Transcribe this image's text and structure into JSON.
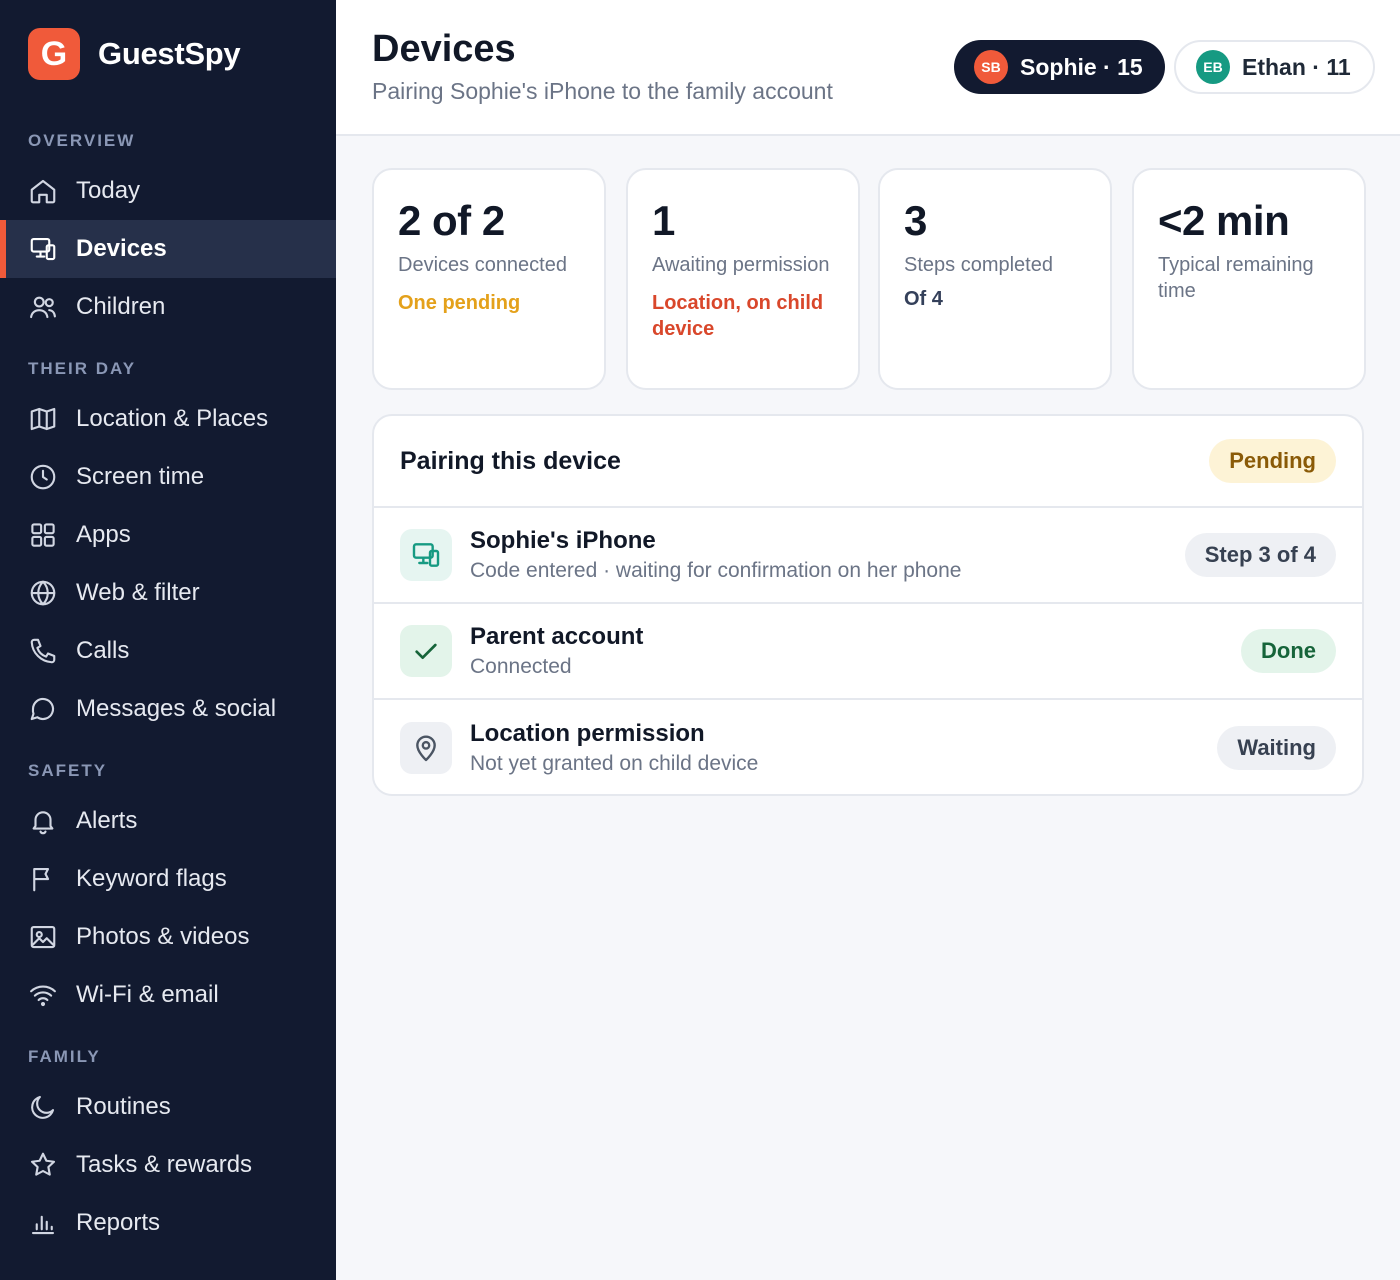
{
  "brand": {
    "logo_letter": "G",
    "name": "GuestSpy"
  },
  "sidebar": {
    "sections": [
      {
        "label": "OVERVIEW"
      },
      {
        "label": "THEIR DAY"
      },
      {
        "label": "SAFETY"
      },
      {
        "label": "FAMILY"
      }
    ],
    "items": [
      {
        "label": "Today",
        "icon": "home-icon"
      },
      {
        "label": "Devices",
        "icon": "devices-icon",
        "active": true
      },
      {
        "label": "Children",
        "icon": "users-icon"
      },
      {
        "label": "Location & Places",
        "icon": "map-icon"
      },
      {
        "label": "Screen time",
        "icon": "clock-icon"
      },
      {
        "label": "Apps",
        "icon": "grid-icon"
      },
      {
        "label": "Web & filter",
        "icon": "globe-icon"
      },
      {
        "label": "Calls",
        "icon": "phone-icon"
      },
      {
        "label": "Messages & social",
        "icon": "message-icon"
      },
      {
        "label": "Alerts",
        "icon": "bell-icon"
      },
      {
        "label": "Keyword flags",
        "icon": "flag-icon"
      },
      {
        "label": "Photos & videos",
        "icon": "image-icon"
      },
      {
        "label": "Wi-Fi & email",
        "icon": "wifi-icon"
      },
      {
        "label": "Routines",
        "icon": "moon-icon"
      },
      {
        "label": "Tasks & rewards",
        "icon": "star-icon"
      },
      {
        "label": "Reports",
        "icon": "chart-icon"
      }
    ]
  },
  "header": {
    "title": "Devices",
    "subtitle": "Pairing Sophie's iPhone to the family account",
    "children": [
      {
        "initials": "SB",
        "label": "Sophie · 15",
        "selected": true,
        "avatar_color": "#f05a3a"
      },
      {
        "initials": "EB",
        "label": "Ethan · 11",
        "selected": false,
        "avatar_color": "#169a82"
      }
    ]
  },
  "stats": [
    {
      "value": "2 of 2",
      "label": "Devices connected",
      "note": "One pending",
      "note_color": "#e4a11b"
    },
    {
      "value": "1",
      "label": "Awaiting permission",
      "note": "Location, on child device",
      "note_color": "#d9472b"
    },
    {
      "value": "3",
      "label": "Steps completed",
      "note": "Of 4",
      "note_color": "#34405a"
    },
    {
      "value": "<2 min",
      "label": "Typical remaining time",
      "note": "",
      "note_color": "#6b7486"
    }
  ],
  "pairing": {
    "title": "Pairing this device",
    "status": "Pending",
    "rows": [
      {
        "title": "Sophie's iPhone",
        "subtitle": "Code entered · waiting for confirmation on her phone",
        "badge": "Step 3 of 4",
        "icon": "devices-icon"
      },
      {
        "title": "Parent account",
        "subtitle": "Connected",
        "badge": "Done",
        "icon": "check-icon"
      },
      {
        "title": "Location permission",
        "subtitle": "Not yet granted on child device",
        "badge": "Waiting",
        "icon": "location-pin-icon"
      }
    ]
  },
  "colors": {
    "accent": "#f05a3a",
    "sidebar_bg": "#121a30",
    "teal": "#169a82"
  }
}
